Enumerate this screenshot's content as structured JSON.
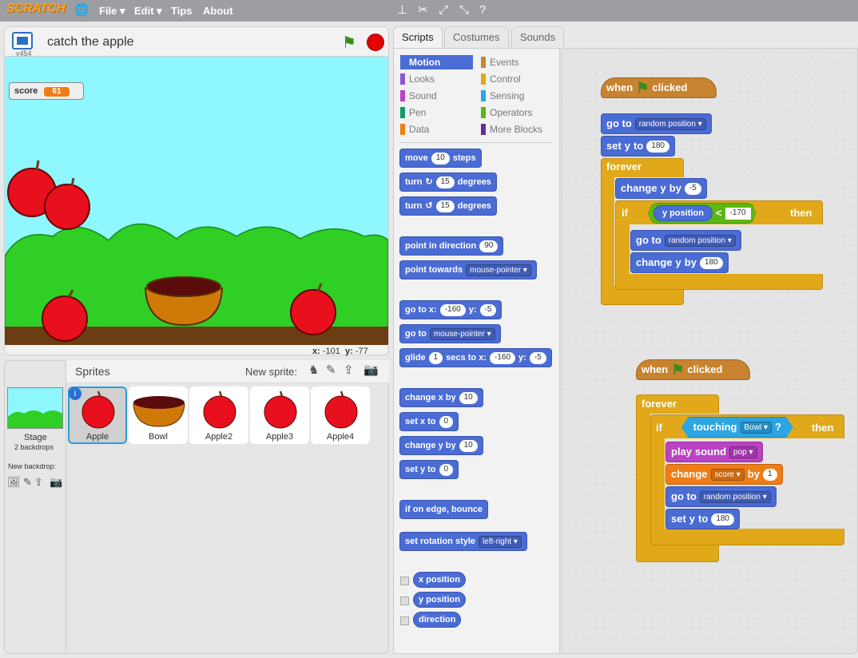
{
  "app": {
    "logo": "SCRATCH"
  },
  "menu": {
    "file": "File ▾",
    "edit": "Edit ▾",
    "tips": "Tips",
    "about": "About"
  },
  "project": {
    "title": "catch the apple",
    "version": "v454"
  },
  "stage": {
    "score_label": "score",
    "score_value": "61",
    "mouse_x_label": "x:",
    "mouse_x": "-101",
    "mouse_y_label": "y:",
    "mouse_y": "-77"
  },
  "sprites_panel": {
    "title": "Sprites",
    "new_sprite_label": "New sprite:",
    "stage_label": "Stage",
    "stage_sub": "2 backdrops",
    "new_backdrop_label": "New backdrop:",
    "sprites": [
      "Apple",
      "Bowl",
      "Apple2",
      "Apple3",
      "Apple4"
    ]
  },
  "tabs": [
    "Scripts",
    "Costumes",
    "Sounds"
  ],
  "categories": {
    "left": [
      "Motion",
      "Looks",
      "Sound",
      "Pen",
      "Data"
    ],
    "right": [
      "Events",
      "Control",
      "Sensing",
      "Operators",
      "More Blocks"
    ]
  },
  "palette": {
    "move": "move",
    "move_val": "10",
    "steps": "steps",
    "turn": "turn",
    "turn_r_val": "15",
    "turn_l_val": "15",
    "degrees": "degrees",
    "point_dir": "point in direction",
    "point_dir_val": "90",
    "point_towards": "point towards",
    "mouse_pointer": "mouse-pointer",
    "goto_xy": "go to x:",
    "goto_x": "-160",
    "y_label": "y:",
    "goto_y": "-5",
    "goto": "go to",
    "glide": "glide",
    "glide_secs": "1",
    "secs_to_x": "secs to x:",
    "glide_x": "-160",
    "glide_y": "-5",
    "change_x": "change x by",
    "change_x_val": "10",
    "set_x": "set x to",
    "set_x_val": "0",
    "change_y": "change y by",
    "change_y_val": "10",
    "set_y": "set y to",
    "set_y_val": "0",
    "bounce": "if on edge, bounce",
    "rot_style": "set rotation style",
    "rot_val": "left-right",
    "x_position": "x position",
    "y_position": "y position",
    "direction": "direction"
  },
  "script1": {
    "when": "when",
    "clicked": "clicked",
    "goto": "go to",
    "random_position": "random position",
    "set_y": "set",
    "y": "y",
    "to": "to",
    "set_y_val": "180",
    "forever": "forever",
    "change_y": "change",
    "by": "by",
    "change_y_val": "-5",
    "if": "if",
    "y_position": "y position",
    "lt": "<",
    "lt_val": "-170",
    "then": "then",
    "inner_goto": "go to",
    "inner_random": "random position",
    "inner_change": "change",
    "inner_y": "y",
    "inner_by": "by",
    "inner_val": "180"
  },
  "script2": {
    "when": "when",
    "clicked": "clicked",
    "forever": "forever",
    "if": "if",
    "touching": "touching",
    "bowl": "Bowl",
    "q": "?",
    "then": "then",
    "play_sound": "play",
    "sound_word": "sound",
    "pop": "pop",
    "change": "change",
    "score_var": "score",
    "by": "by",
    "change_val": "1",
    "goto": "go to",
    "random_position": "random position",
    "set": "set",
    "y": "y",
    "to": "to",
    "set_val": "180"
  },
  "colors": {
    "motion": "#4a6cd4",
    "events": "#c88330",
    "control": "#e1a91a",
    "sensing": "#2ca5e2",
    "operators": "#5cb712",
    "data": "#ee7d16",
    "sound": "#bb42c3",
    "looks": "#8a55d7",
    "pen": "#0e9a6c",
    "more_blocks": "#632d99"
  }
}
